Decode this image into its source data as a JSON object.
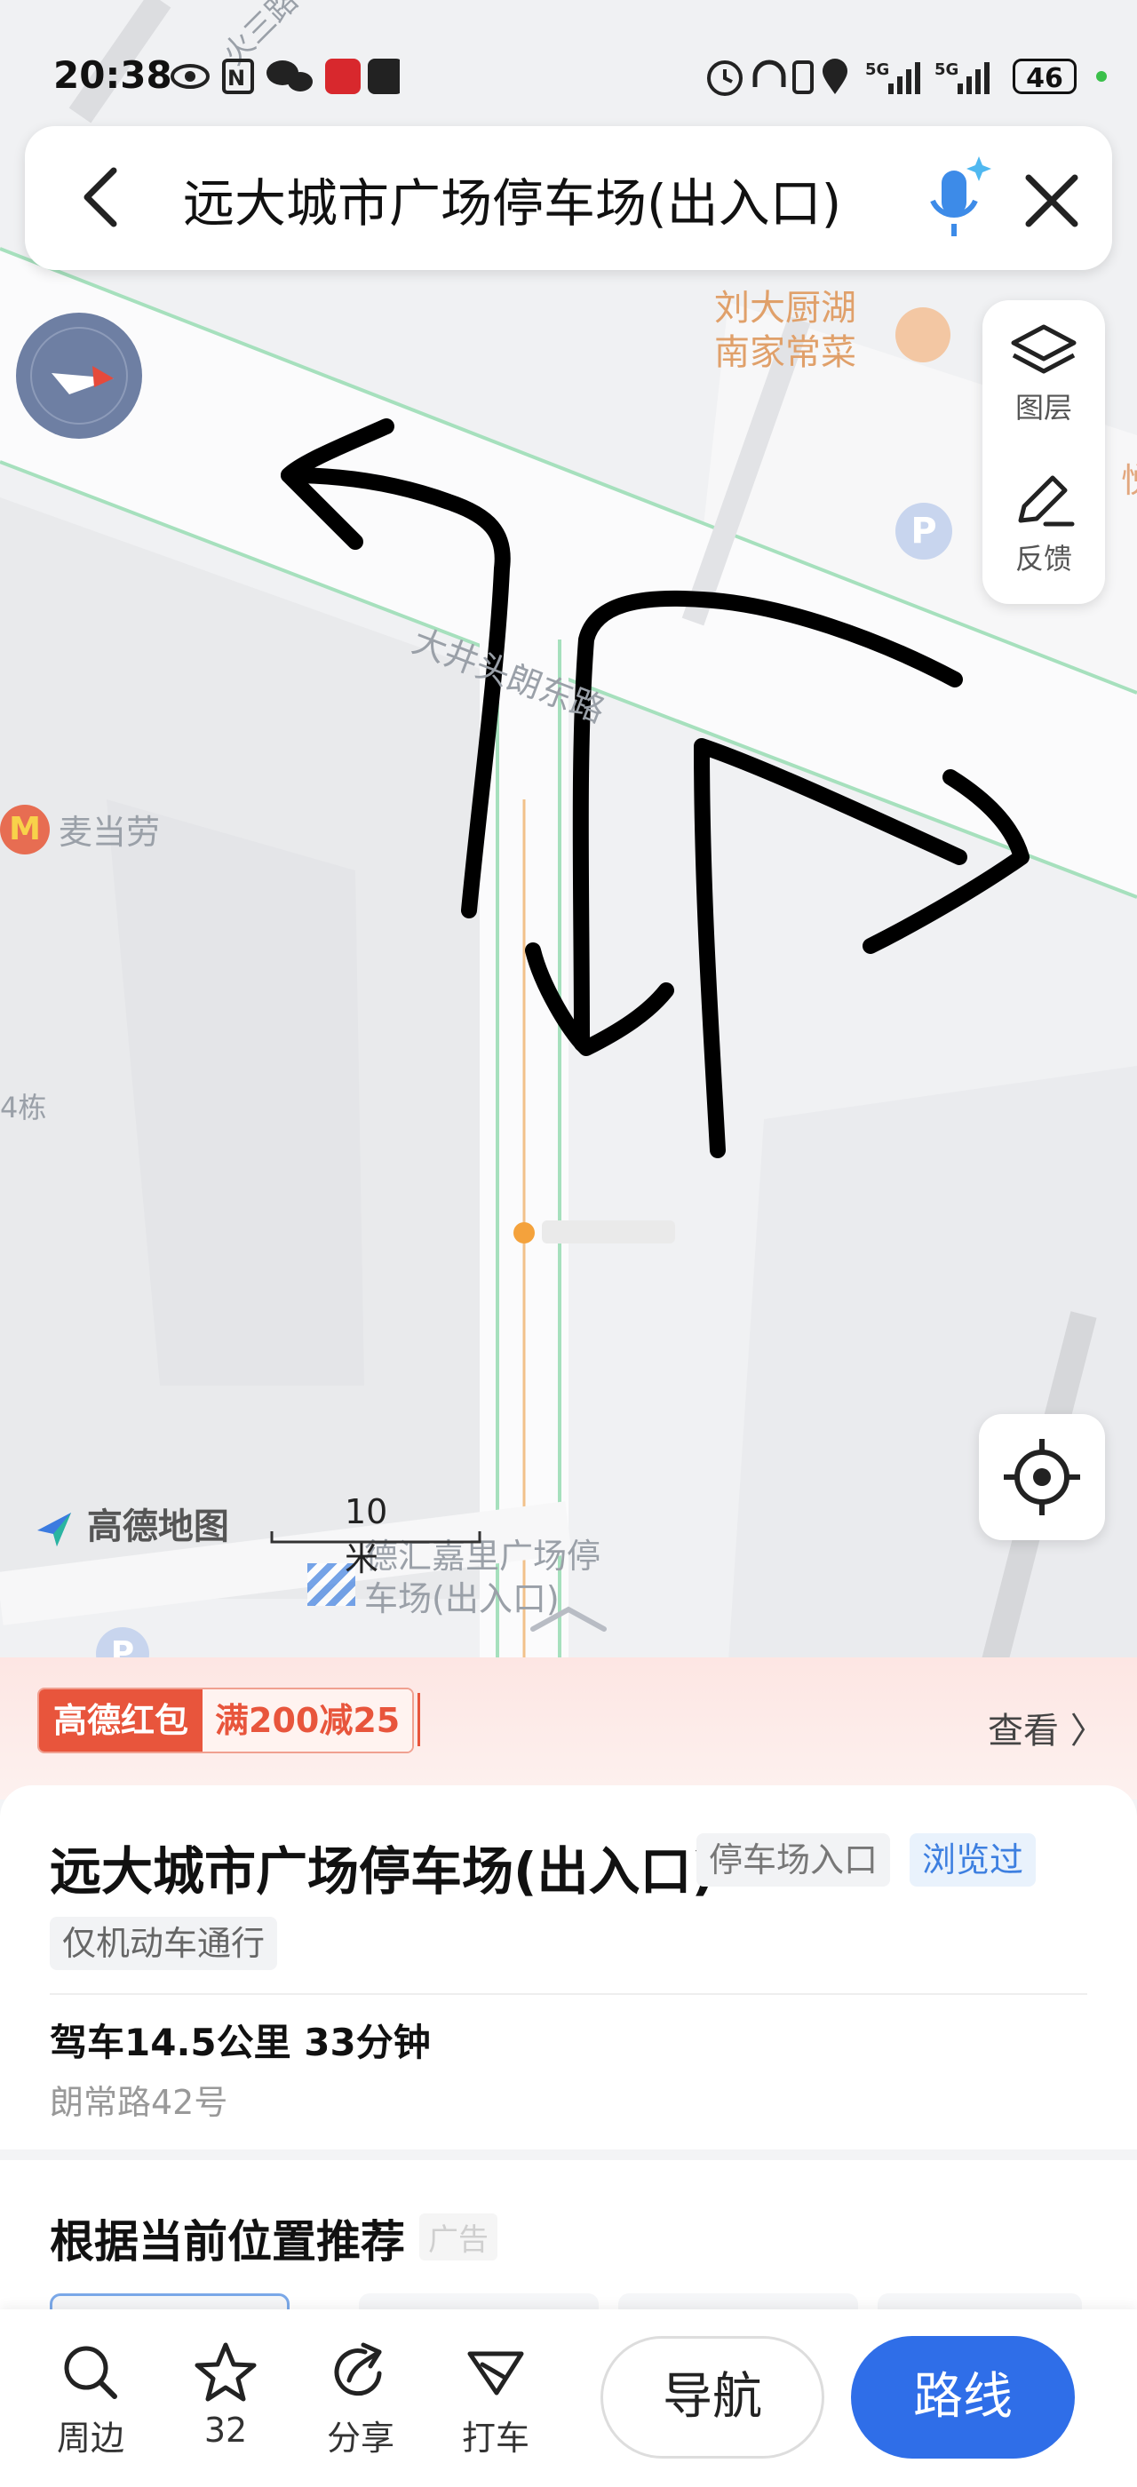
{
  "status_bar": {
    "time": "20:38",
    "battery": "46"
  },
  "search": {
    "title": "远大城市广场停车场(出入口)"
  },
  "map": {
    "labels": {
      "road_top": "火三路",
      "road_main": "大井头朗东路",
      "restaurant": "刘大厨湖\n南家常菜",
      "mcdonalds": "麦当劳",
      "building": "4栋",
      "parking_entrance": "德汇嘉里广场停\n车场(出入口)",
      "edge_right": "悦"
    },
    "tools": {
      "layers": "图层",
      "feedback": "反馈"
    },
    "scale": "10米",
    "logo": "高德地图"
  },
  "promo": {
    "tag_a": "高德红包",
    "tag_b": "满200减25",
    "view": "查看 〉"
  },
  "place": {
    "name": "远大城市广场停车场(出入口)",
    "type": "停车场入口",
    "viewed": "浏览过",
    "vehicle": "仅机动车通行",
    "drive": "驾车14.5公里 33分钟",
    "address": "朗常路42号"
  },
  "recommend": {
    "title": "根据当前位置推荐",
    "ad": "广告"
  },
  "toolbar": {
    "nearby": "周边",
    "favorites": "32",
    "share": "分享",
    "taxi": "打车",
    "navigate": "导航",
    "route": "路线"
  },
  "colors": {
    "accent": "#2f6ee8",
    "promo": "#e8553c",
    "road_line": "#9fdcb7"
  }
}
